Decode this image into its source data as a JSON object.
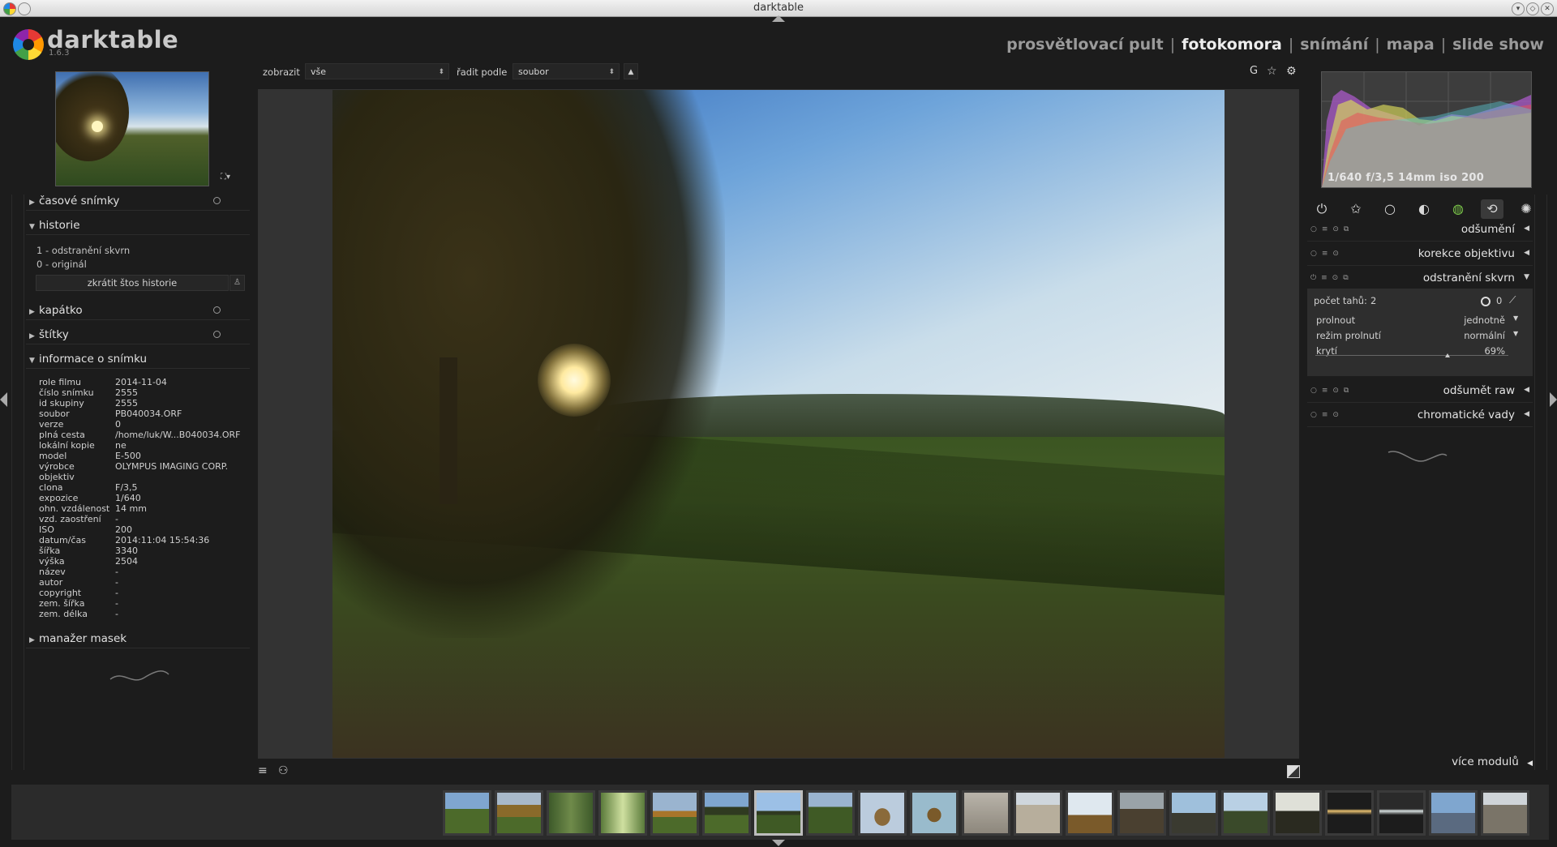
{
  "window": {
    "title": "darktable"
  },
  "app": {
    "name": "darktable",
    "version": "1.6.3"
  },
  "views": {
    "items": [
      "prosvětlovací pult",
      "fotokomora",
      "snímání",
      "mapa",
      "slide show"
    ],
    "separator": "|",
    "active": "fotokomora"
  },
  "toolbar": {
    "show_label": "zobrazit",
    "show_value": "vše",
    "sort_label": "řadit podle",
    "sort_value": "soubor",
    "sort_dir": "▲",
    "grouping": "G",
    "star_icon": "star-icon",
    "settings_icon": "gear-icon"
  },
  "left_panel": {
    "sections": {
      "snapshots": "časové snímky",
      "history": "historie",
      "colorpicker": "kapátko",
      "tags": "štítky",
      "image_info": "informace o snímku",
      "mask_manager": "manažer masek"
    },
    "history_items": [
      "1 - odstranění skvrn",
      "0 - originál"
    ],
    "compress_button": "zkrátit štos historie",
    "image_info": [
      {
        "k": "role filmu",
        "v": "2014-11-04"
      },
      {
        "k": "číslo snímku",
        "v": "2555"
      },
      {
        "k": "id skupiny",
        "v": "2555"
      },
      {
        "k": "soubor",
        "v": "PB040034.ORF"
      },
      {
        "k": "verze",
        "v": "0"
      },
      {
        "k": "plná cesta",
        "v": "/home/luk/W...B040034.ORF"
      },
      {
        "k": "lokální kopie",
        "v": "ne"
      },
      {
        "k": "model",
        "v": "E-500"
      },
      {
        "k": "výrobce",
        "v": "OLYMPUS IMAGING CORP."
      },
      {
        "k": "objektiv",
        "v": ""
      },
      {
        "k": "clona",
        "v": "F/3,5"
      },
      {
        "k": "expozice",
        "v": "1/640"
      },
      {
        "k": "ohn. vzdálenost",
        "v": "14 mm"
      },
      {
        "k": "vzd. zaostření",
        "v": "-"
      },
      {
        "k": "ISO",
        "v": "200"
      },
      {
        "k": "datum/čas",
        "v": "2014:11:04 15:54:36"
      },
      {
        "k": "šířka",
        "v": "3340"
      },
      {
        "k": "výška",
        "v": "2504"
      },
      {
        "k": "název",
        "v": "-"
      },
      {
        "k": "autor",
        "v": "-"
      },
      {
        "k": "copyright",
        "v": "-"
      },
      {
        "k": "zem. šířka",
        "v": "-"
      },
      {
        "k": "zem. délka",
        "v": "-"
      }
    ]
  },
  "right_panel": {
    "histogram_info": "1/640 f/3,5 14mm iso 200",
    "group_icons": [
      "power-icon",
      "star-outline-icon",
      "circle-icon",
      "shaded-circle-icon",
      "color-wheel-icon",
      "loop-icon",
      "effects-icon"
    ],
    "modules": [
      "odšumění",
      "korekce objektivu",
      "odstranění skvrn",
      "odšumět raw",
      "chromatické vady"
    ],
    "spot_removal": {
      "strokes_label": "počet tahů:",
      "strokes_value": "2",
      "shape_count": "0",
      "blend_label": "prolnout",
      "blend_value": "jednotně",
      "blend_mode_label": "režim prolnutí",
      "blend_mode_value": "normální",
      "opacity_label": "krytí",
      "opacity_value": "69%",
      "opacity": 0.69
    },
    "more_modules": "více modulů"
  },
  "filmstrip": {
    "count": 21,
    "selected_index": 6
  }
}
